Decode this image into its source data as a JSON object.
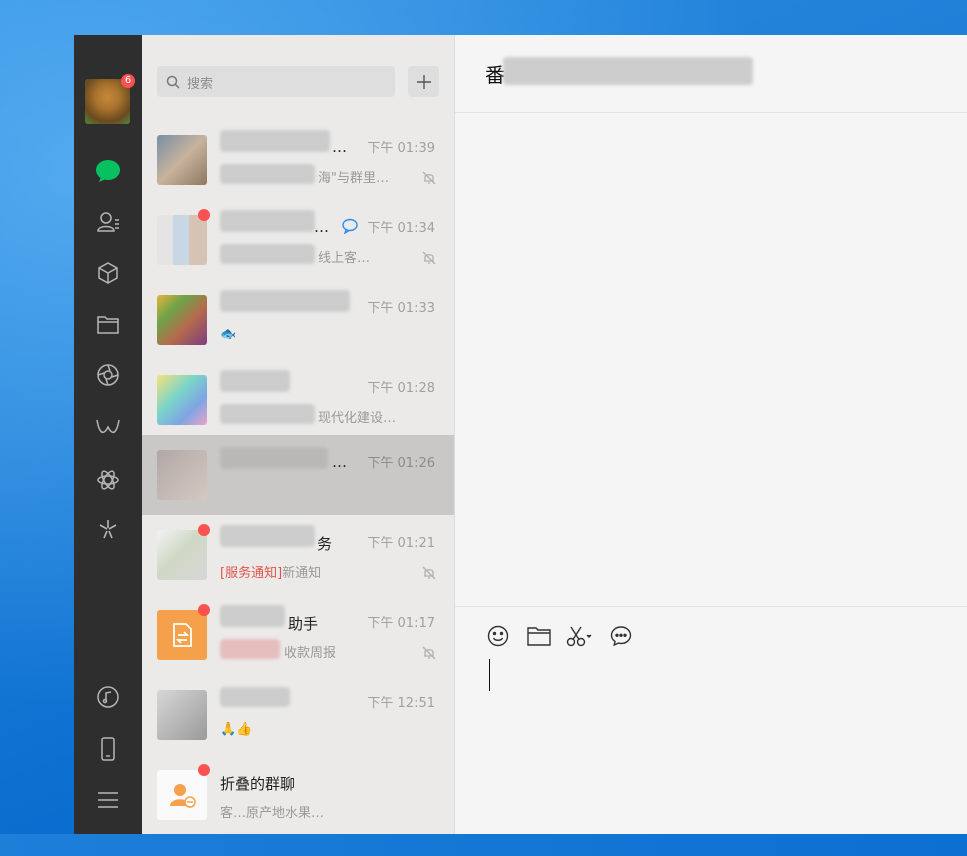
{
  "window": {
    "avatar_badge": "6"
  },
  "nav_icons": [
    "chat-icon",
    "contacts-icon",
    "cube-icon",
    "folder-icon",
    "moments-icon",
    "channels-icon",
    "mini-program-icon",
    "discover-icon",
    "music-icon",
    "phone-icon",
    "menu-icon"
  ],
  "search": {
    "placeholder": "搜索"
  },
  "chats": [
    {
      "name": "…",
      "time": "下午 01:39",
      "preview": "海\"与群里…",
      "muted": true
    },
    {
      "name": "…",
      "time": "下午 01:34",
      "preview": "线上客…",
      "muted": true
    },
    {
      "name": "…",
      "time": "下午 01:33",
      "preview": "",
      "muted": false
    },
    {
      "name": "",
      "time": "下午 01:28",
      "preview": "现代化建设…",
      "muted": false
    },
    {
      "name": "…",
      "time": "下午 01:26",
      "preview": "",
      "muted": false,
      "selected": true
    },
    {
      "name": "务",
      "time": "下午 01:21",
      "preview_tag": "[服务通知]",
      "preview": "新通知",
      "muted": true
    },
    {
      "name": "助手",
      "time": "下午 01:17",
      "preview": "收款周报",
      "muted": true
    },
    {
      "name": "",
      "time": "下午 12:51",
      "preview": "🙏👍",
      "muted": false
    },
    {
      "name": "折叠的群聊",
      "time": "",
      "preview": "客…原产地水果…",
      "muted": false
    }
  ],
  "chat_pane": {
    "title": "番",
    "toolbar": [
      "emoji-icon",
      "file-icon",
      "screenshot-icon",
      "chat-history-icon"
    ]
  },
  "colors": {
    "accent": "#07c160",
    "badge": "#fa5151",
    "nav_bg": "#2e2e2e"
  }
}
